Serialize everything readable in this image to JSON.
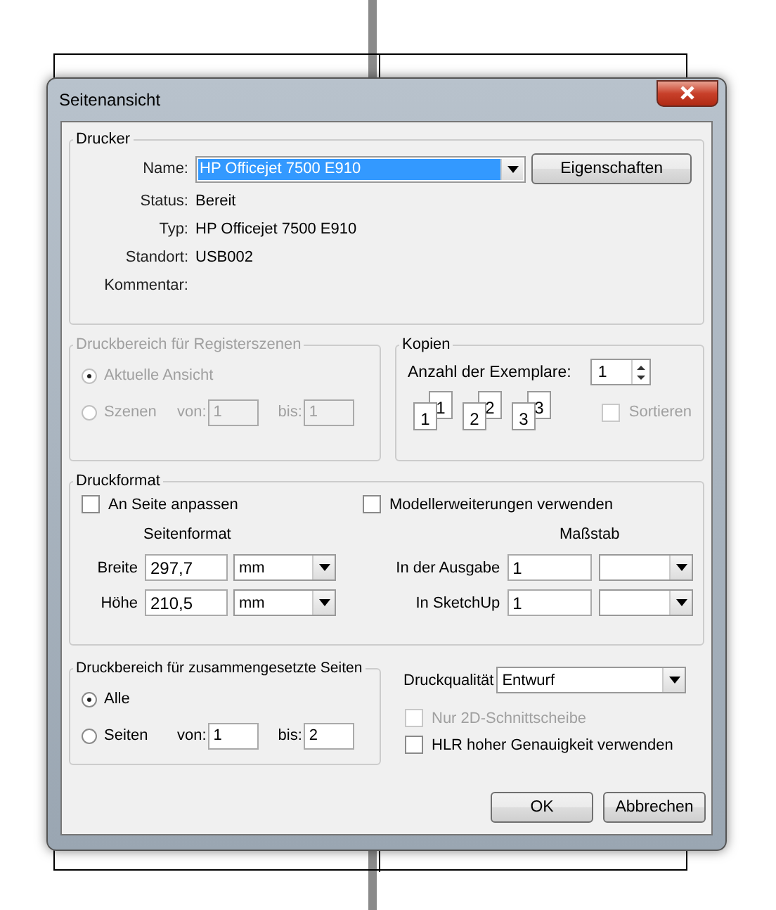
{
  "window": {
    "title": "Seitenansicht"
  },
  "printer": {
    "legend": "Drucker",
    "name_label": "Name:",
    "name_value": "HP Officejet 7500 E910",
    "properties_button": "Eigenschaften",
    "info": [
      {
        "label": "Status:",
        "value": "Bereit"
      },
      {
        "label": "Typ:",
        "value": "HP Officejet 7500 E910"
      },
      {
        "label": "Standort:",
        "value": "USB002"
      },
      {
        "label": "Kommentar:"
      }
    ]
  },
  "scene_range": {
    "legend": "Druckbereich für Registerszenen",
    "disabled": true,
    "options": [
      {
        "label": "Aktuelle Ansicht",
        "selected": true
      },
      {
        "label": "Szenen",
        "selected": false
      }
    ],
    "from_label": "von:",
    "from_value": "1",
    "to_label": "bis:",
    "to_value": "1"
  },
  "copies": {
    "legend": "Kopien",
    "count_label": "Anzahl der Exemplare:",
    "count_value": "1",
    "collate_pages": [
      {
        "back": "1",
        "front": "1"
      },
      {
        "back": "2",
        "front": "2"
      },
      {
        "back": "3",
        "front": "3"
      }
    ],
    "collate": {
      "label": "Sortieren",
      "checked": false,
      "disabled": true
    }
  },
  "print_format": {
    "legend": "Druckformat",
    "checkboxes": [
      {
        "label": "An Seite anpassen",
        "checked": false
      },
      {
        "label": "Modellerweiterungen verwenden",
        "checked": false
      }
    ],
    "page_size": {
      "heading": "Seitenformat",
      "rows": [
        {
          "label": "Breite",
          "value": "297,7",
          "unit": "mm"
        },
        {
          "label": "Höhe",
          "value": "210,5",
          "unit": "mm"
        }
      ]
    },
    "scale": {
      "heading": "Maßstab",
      "rows": [
        {
          "label": "In der Ausgabe",
          "value": "1"
        },
        {
          "label": "In SketchUp",
          "value": "1"
        }
      ]
    }
  },
  "page_range": {
    "legend": "Druckbereich für zusammengesetzte Seiten",
    "options": [
      {
        "label": "Alle",
        "selected": true
      },
      {
        "label": "Seiten",
        "selected": false
      }
    ],
    "from_label": "von:",
    "from_value": "1",
    "to_label": "bis:",
    "to_value": "2"
  },
  "quality": {
    "label": "Druckqualität",
    "value": "Entwurf"
  },
  "options": [
    {
      "label": "Nur 2D-Schnittscheibe",
      "checked": false,
      "disabled": true
    },
    {
      "label": "HLR hoher Genauigkeit verwenden",
      "checked": false,
      "disabled": false
    }
  ],
  "buttons": [
    {
      "label": "OK"
    },
    {
      "label": "Abbrechen"
    }
  ]
}
